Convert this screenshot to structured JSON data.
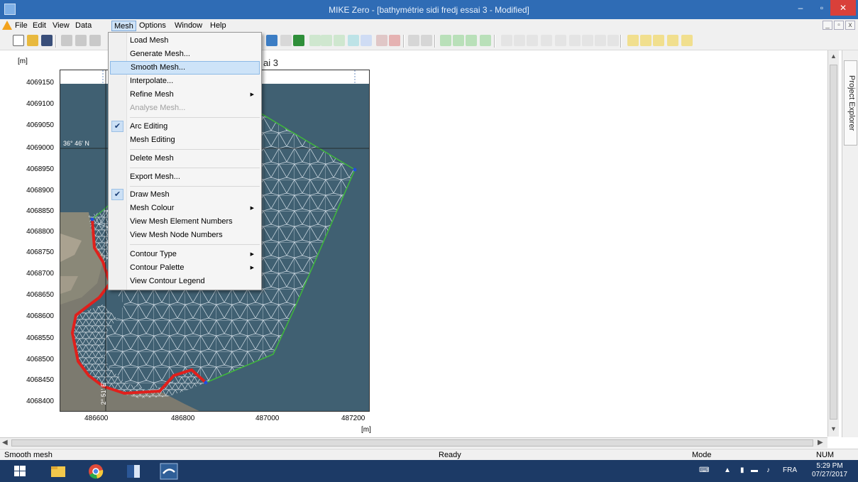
{
  "window": {
    "title": "MIKE Zero - [bathymétrie sidi fredj essai 3 - Modified]",
    "minimize": "–",
    "maximize": "▫",
    "close": "✕"
  },
  "menubar": {
    "items": [
      "File",
      "Edit",
      "View",
      "Data",
      "Mesh",
      "Options",
      "Window",
      "Help"
    ],
    "mdi_buttons": [
      "_",
      "▫",
      "x"
    ]
  },
  "mesh_menu": {
    "items": [
      {
        "label": "Load Mesh"
      },
      {
        "label": "Generate Mesh..."
      },
      {
        "label": "Smooth Mesh..."
      },
      {
        "label": "Interpolate..."
      },
      {
        "label": "Refine Mesh"
      },
      {
        "label": "Analyse Mesh..."
      },
      {
        "label": "Arc Editing"
      },
      {
        "label": "Mesh Editing"
      },
      {
        "label": "Delete Mesh"
      },
      {
        "label": "Export Mesh..."
      },
      {
        "label": "Draw Mesh"
      },
      {
        "label": "Mesh Colour"
      },
      {
        "label": "View Mesh Element Numbers"
      },
      {
        "label": "View Mesh Node Numbers"
      },
      {
        "label": "Contour Type"
      },
      {
        "label": "Contour Palette"
      },
      {
        "label": "View Contour Legend"
      }
    ],
    "check_glyph": "✔",
    "submenu_glyph": "▶"
  },
  "view": {
    "title_fragment": "ai 3",
    "y_unit": "[m]",
    "x_unit": "[m]",
    "y_ticks": [
      "4069150",
      "4069100",
      "4069050",
      "4069000",
      "4068950",
      "4068900",
      "4068850",
      "4068800",
      "4068750",
      "4068700",
      "4068650",
      "4068600",
      "4068550",
      "4068500",
      "4068450",
      "4068400"
    ],
    "x_ticks": [
      "486600",
      "486800",
      "487000",
      "487200"
    ],
    "graticule_lat": "36° 46' N",
    "graticule_lon": "2° 51' E"
  },
  "explorer": {
    "label": "Project Explorer"
  },
  "statusbar": {
    "left": "Smooth mesh",
    "center": "Ready",
    "mode": "Mode",
    "num": "NUM"
  },
  "taskbar": {
    "lang": "FRA",
    "time": "5:29 PM",
    "date": "07/27/2017"
  },
  "colors": {
    "titlebar": "#2f6cb5",
    "taskbar": "#1c3a66",
    "menu_hover": "#cde3f8",
    "sea": "#3b5b6e",
    "mesh_lines": "#dce6ee",
    "boundary_red": "#e0201c",
    "boundary_green": "#3fb83b"
  }
}
